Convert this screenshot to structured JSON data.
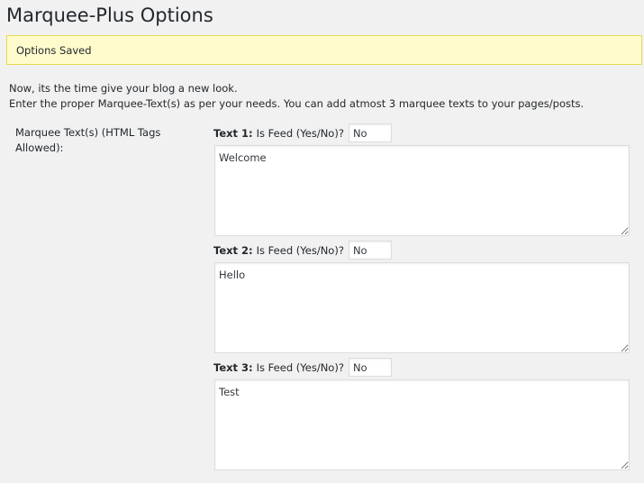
{
  "page": {
    "title": "Marquee-Plus Options",
    "notice": "Options Saved",
    "intro_line1": "Now, its the time give your blog a new look.",
    "intro_line2": "Enter the proper Marquee-Text(s) as per your needs. You can add atmost 3 marquee texts to your pages/posts."
  },
  "form": {
    "field_label": "Marquee Text(s) (HTML Tags Allowed):",
    "feed_prompt": "Is Feed (Yes/No)?",
    "texts": [
      {
        "label": "Text 1:",
        "is_feed": "No",
        "value": "Welcome"
      },
      {
        "label": "Text 2:",
        "is_feed": "No",
        "value": "Hello"
      },
      {
        "label": "Text 3:",
        "is_feed": "No",
        "value": "Test"
      }
    ]
  }
}
